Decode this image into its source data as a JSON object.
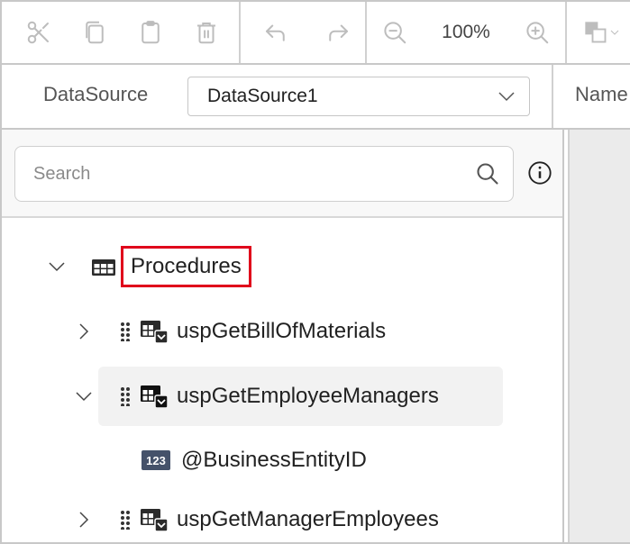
{
  "toolbar": {
    "edit_buttons": [
      {
        "name": "cut",
        "icon": "scissors-icon"
      },
      {
        "name": "copy",
        "icon": "copy-icon"
      },
      {
        "name": "paste",
        "icon": "clipboard-icon"
      },
      {
        "name": "delete",
        "icon": "trash-icon"
      }
    ],
    "history_buttons": [
      {
        "name": "undo",
        "icon": "undo-icon"
      },
      {
        "name": "redo",
        "icon": "redo-icon"
      }
    ],
    "zoom": {
      "level": "100%",
      "zoom_out_icon": "zoom-out-icon",
      "zoom_in_icon": "zoom-in-icon"
    },
    "arrange_icon": "bring-forward-icon"
  },
  "properties": {
    "datasource_label": "DataSource",
    "datasource_value": "DataSource1",
    "name_label": "Name"
  },
  "search": {
    "placeholder": "Search",
    "value": ""
  },
  "tree": {
    "root": {
      "label": "Procedures",
      "expanded": true,
      "highlighted": true
    },
    "items": [
      {
        "label": "uspGetBillOfMaterials",
        "expanded": false,
        "selected": false
      },
      {
        "label": "uspGetEmployeeManagers",
        "expanded": true,
        "selected": true,
        "children": [
          {
            "label": "@BusinessEntityID",
            "type_badge": "123"
          }
        ]
      },
      {
        "label": "uspGetManagerEmployees",
        "expanded": false,
        "selected": false
      }
    ]
  },
  "colors": {
    "highlight_border": "#e0001b",
    "param_badge": "#45526a",
    "selected_row_bg": "#f2f2f2",
    "right_panel_bg": "#ebebeb",
    "disabled_icon": "#bdbdbd"
  }
}
